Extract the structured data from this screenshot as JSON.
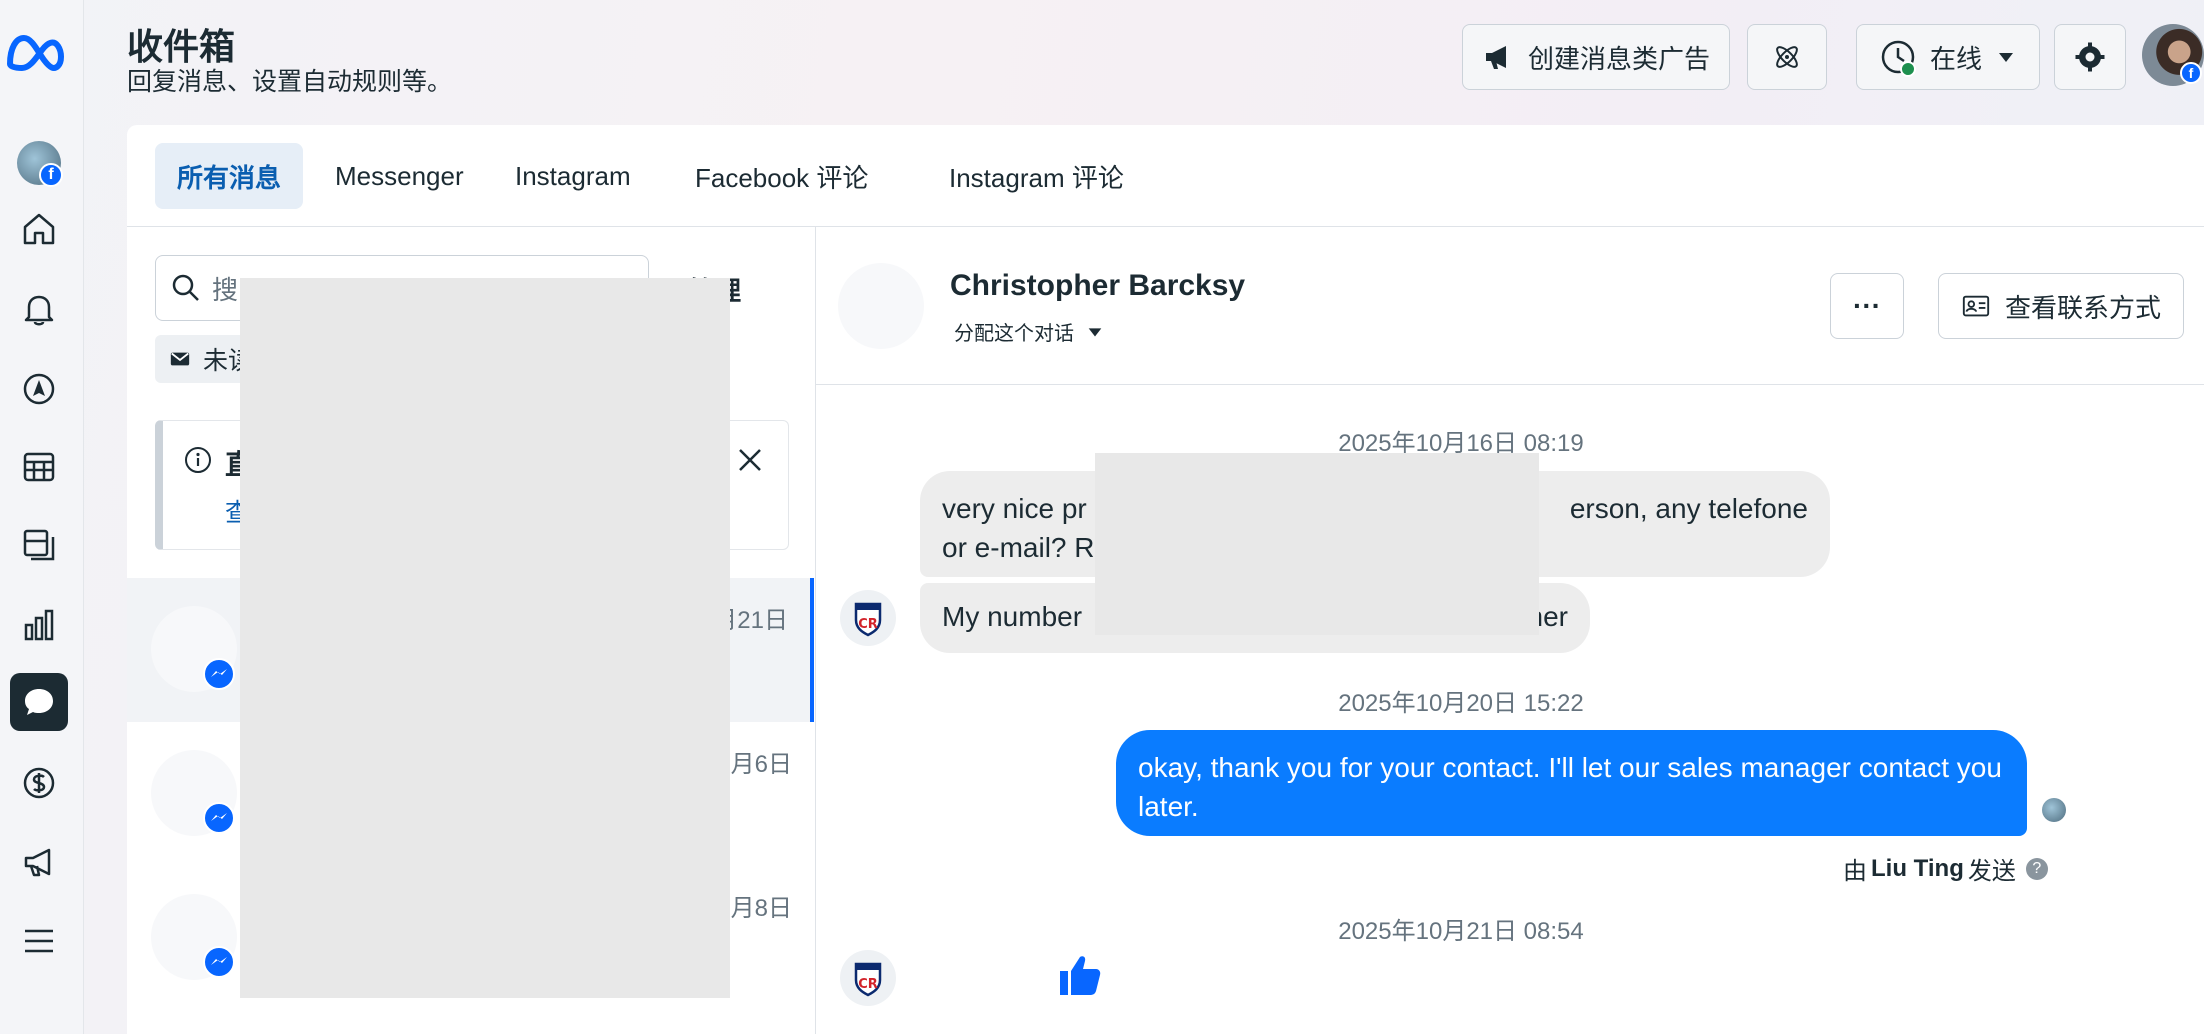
{
  "header": {
    "title": "收件箱",
    "subtitle": "回复消息、设置自动规则等。",
    "create_ad_label": "创建消息类广告",
    "status_label": "在线"
  },
  "tabs": [
    {
      "label": "所有消息",
      "active": true
    },
    {
      "label": "Messenger",
      "active": false
    },
    {
      "label": "Instagram",
      "active": false
    },
    {
      "label": "Facebook 评论",
      "active": false
    },
    {
      "label": "Instagram 评论",
      "active": false
    }
  ],
  "list": {
    "search_placeholder": "搜",
    "manage_label": "管理",
    "unread_label": "未读",
    "notice_title": "直",
    "notice_link": "查",
    "conversations": [
      {
        "date": "月21日",
        "selected": true
      },
      {
        "date": "月6日",
        "selected": false
      },
      {
        "date": "月8日",
        "selected": false
      }
    ]
  },
  "thread": {
    "contact_name": "Christopher Barcksy",
    "assign_label": "分配这个对话",
    "more_label": "···",
    "view_contact_label": "查看联系方式",
    "messages": [
      {
        "timestamp": "2025年10月16日 08:19"
      },
      {
        "direction": "in",
        "line1": "very nice pr",
        "line1_end": "erson, any telefone",
        "line2": "or e-mail? R"
      },
      {
        "direction": "in",
        "text": "My number",
        "text_end": "her"
      },
      {
        "timestamp": "2025年10月20日 15:22"
      },
      {
        "direction": "out",
        "text": "okay, thank you for your contact. I'll let our sales manager contact you later."
      },
      {
        "sent_by_prefix": "由",
        "sent_by_name": "Liu Ting",
        "sent_by_suffix": "发送"
      },
      {
        "timestamp": "2025年10月21日 08:54"
      }
    ]
  },
  "colors": {
    "accent": "#0866ff",
    "outgoing_bubble": "#0a7cff",
    "incoming_bubble": "#ededed",
    "active_tab_bg": "#e6eef7",
    "active_tab_text": "#0a5eb0"
  }
}
